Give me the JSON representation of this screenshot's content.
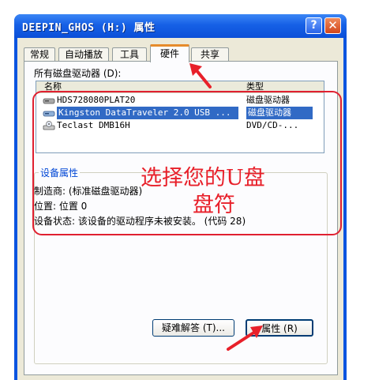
{
  "window": {
    "title": "DEEPIN_GHOS (H:) 属性",
    "help_label": "?",
    "close_label": "✕"
  },
  "tabs": [
    {
      "label": "常规"
    },
    {
      "label": "自动播放"
    },
    {
      "label": "工具"
    },
    {
      "label": "硬件"
    },
    {
      "label": "共享"
    }
  ],
  "hardware": {
    "devices_label": "所有磁盘驱动器 (D):",
    "columns": {
      "name": "名称",
      "type": "类型"
    },
    "devices": [
      {
        "name": "HDS728080PLAT20",
        "type": "磁盘驱动器",
        "icon": "hard-disk-icon"
      },
      {
        "name": "Kingston DataTraveler 2.0 USB ...",
        "type": "磁盘驱动器",
        "icon": "usb-disk-icon"
      },
      {
        "name": "Teclast DMB16H",
        "type": "DVD/CD-...",
        "icon": "cd-drive-icon"
      }
    ],
    "properties_group": {
      "title": "设备属性",
      "manufacturer": "制造商: (标准磁盘驱动器)",
      "location": "位置: 位置 0",
      "status": "设备状态: 该设备的驱动程序未被安装。 (代码 28)"
    },
    "troubleshoot_label": "疑难解答 (T)...",
    "properties_label": "属性 (R)"
  },
  "annotation": {
    "line1": "选择您的U盘",
    "line2": "盘符"
  },
  "colors": {
    "titlebar": "#0a54e0",
    "selection": "#316ac5",
    "annotation": "#e8202a",
    "tab_highlight": "#e68b2c"
  }
}
